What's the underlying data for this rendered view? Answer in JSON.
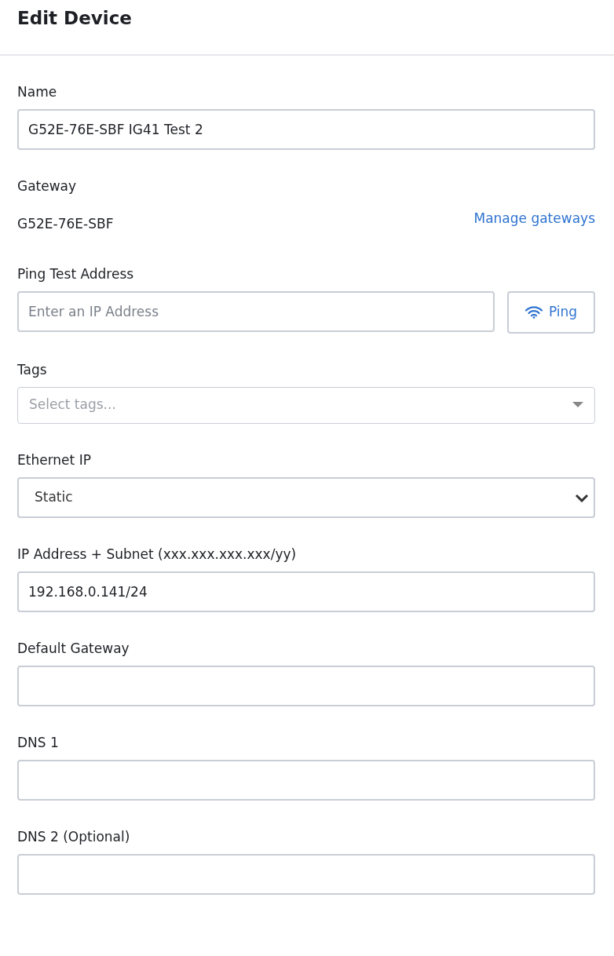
{
  "window": {
    "title": "Edit Device"
  },
  "fields": [
    {
      "kind": "text",
      "label": "Name",
      "value": "G52E-76E-SBF IG41 Test 2"
    },
    {
      "kind": "static",
      "label": "Gateway",
      "value": "G52E-76E-SBF",
      "link": "Manage gateways"
    },
    {
      "kind": "ping",
      "label": "Ping Test Address",
      "placeholder": "Enter an IP Address",
      "button": "Ping"
    },
    {
      "kind": "tags",
      "label": "Tags",
      "placeholder": "Select tags..."
    },
    {
      "kind": "select",
      "label": "Ethernet IP",
      "value": "Static"
    },
    {
      "kind": "text",
      "label": "IP Address + Subnet (xxx.xxx.xxx.xxx/yy)",
      "value": "192.168.0.141/24"
    },
    {
      "kind": "text",
      "label": "Default Gateway"
    },
    {
      "kind": "text",
      "label": "DNS 1"
    },
    {
      "kind": "text",
      "label": "DNS 2 (Optional)"
    }
  ]
}
